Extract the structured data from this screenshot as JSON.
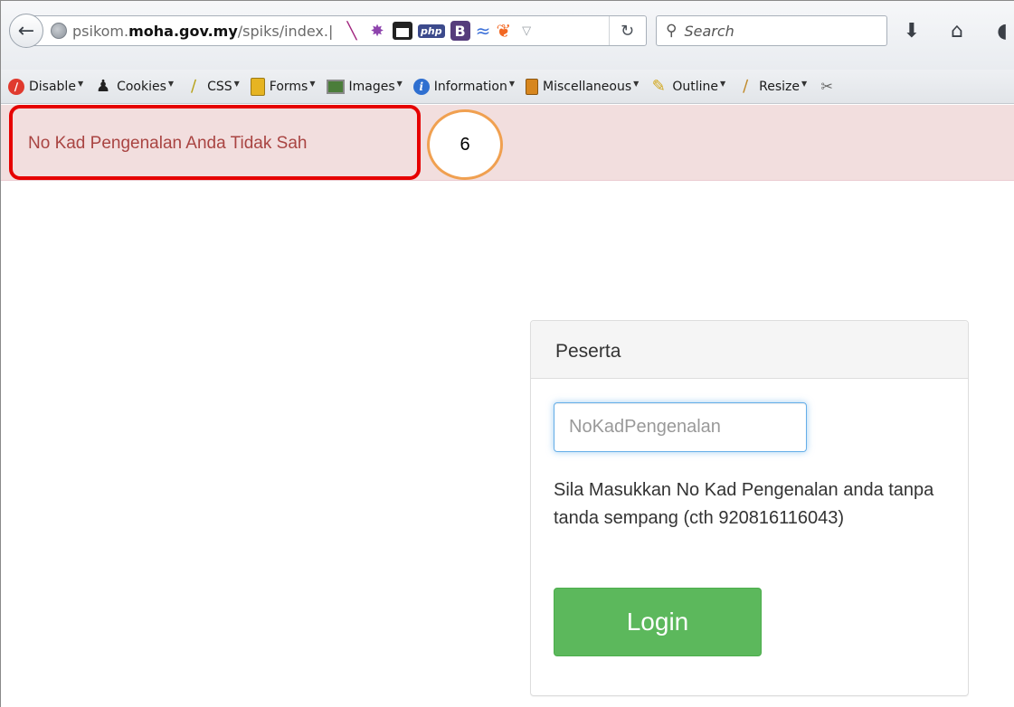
{
  "browser": {
    "url": {
      "prefix": "psikom.",
      "domain": "moha.gov.my",
      "path": "/spiks/index.|"
    },
    "search": {
      "placeholder": "Search"
    },
    "extensions": [
      "feather-icon",
      "puzzle-icon",
      "box-icon",
      "php-icon",
      "bootstrap-icon",
      "wave-icon",
      "fire-icon"
    ],
    "php_label": "php",
    "bootstrap_label": "B"
  },
  "devbar": {
    "items": [
      {
        "label": "Disable",
        "icon": "disable-icon"
      },
      {
        "label": "Cookies",
        "icon": "cookies-icon"
      },
      {
        "label": "CSS",
        "icon": "css-icon"
      },
      {
        "label": "Forms",
        "icon": "forms-icon"
      },
      {
        "label": "Images",
        "icon": "images-icon"
      },
      {
        "label": "Information",
        "icon": "information-icon"
      },
      {
        "label": "Miscellaneous",
        "icon": "miscellaneous-icon"
      },
      {
        "label": "Outline",
        "icon": "outline-icon"
      },
      {
        "label": "Resize",
        "icon": "resize-icon"
      }
    ]
  },
  "alert": {
    "message": "No Kad Pengenalan Anda Tidak Sah",
    "annotation_number": "6"
  },
  "login_panel": {
    "heading": "Peserta",
    "input_placeholder": "NoKadPengenalan",
    "help_text": "Sila Masukkan No Kad Pengenalan anda tanpa tanda sempang (cth 920816116043)",
    "button_label": "Login"
  },
  "colors": {
    "alert_bg": "#f2dede",
    "alert_text": "#a94442",
    "highlight_border": "#e60000",
    "badge_border": "#f0a050",
    "login_button": "#5cb85c",
    "input_focus": "#66afe9"
  }
}
